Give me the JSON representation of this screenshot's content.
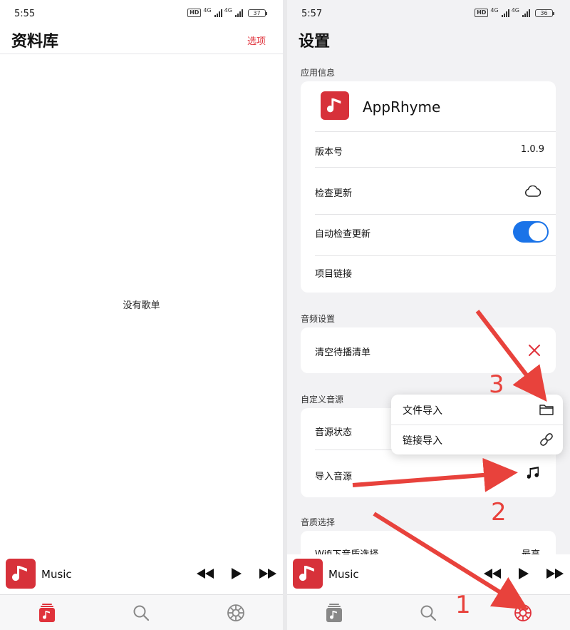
{
  "colors": {
    "accent": "#e0323b",
    "album_red": "#d7313a",
    "toggle_blue": "#1a73e8",
    "annotation_red": "#e8423c"
  },
  "left": {
    "status": {
      "time": "5:55",
      "battery": "37",
      "network": "4G",
      "hd": "HD"
    },
    "title": "资料库",
    "options": "选项",
    "empty_message": "没有歌单",
    "player": {
      "title": "Music"
    }
  },
  "right": {
    "status": {
      "time": "5:57",
      "battery": "36",
      "network": "4G",
      "hd": "HD"
    },
    "title": "设置",
    "sections": {
      "app_info": "应用信息",
      "audio": "音频设置",
      "custom_source": "自定义音源",
      "quality": "音质选择"
    },
    "app": {
      "name": "AppRhyme"
    },
    "rows": {
      "version_label": "版本号",
      "version_value": "1.0.9",
      "check_update": "检查更新",
      "auto_check": "自动检查更新",
      "project_link": "项目链接",
      "clear_queue": "清空待播清单",
      "source_status": "音源状态",
      "import_source": "导入音源",
      "wifi_quality": "Wifi下音质选择",
      "wifi_quality_value": "最高"
    },
    "popup": {
      "file_import": "文件导入",
      "link_import": "链接导入"
    },
    "player": {
      "title": "Music"
    },
    "annotations": {
      "step1": "1",
      "step2": "2",
      "step3": "3"
    },
    "auto_check_enabled": true
  },
  "icons": [
    "music-note-icon",
    "rewind-icon",
    "play-icon",
    "fast-forward-icon",
    "library-icon",
    "search-icon",
    "settings-gear-icon",
    "cloud-icon",
    "close-x-icon",
    "folder-icon",
    "link-icon"
  ]
}
